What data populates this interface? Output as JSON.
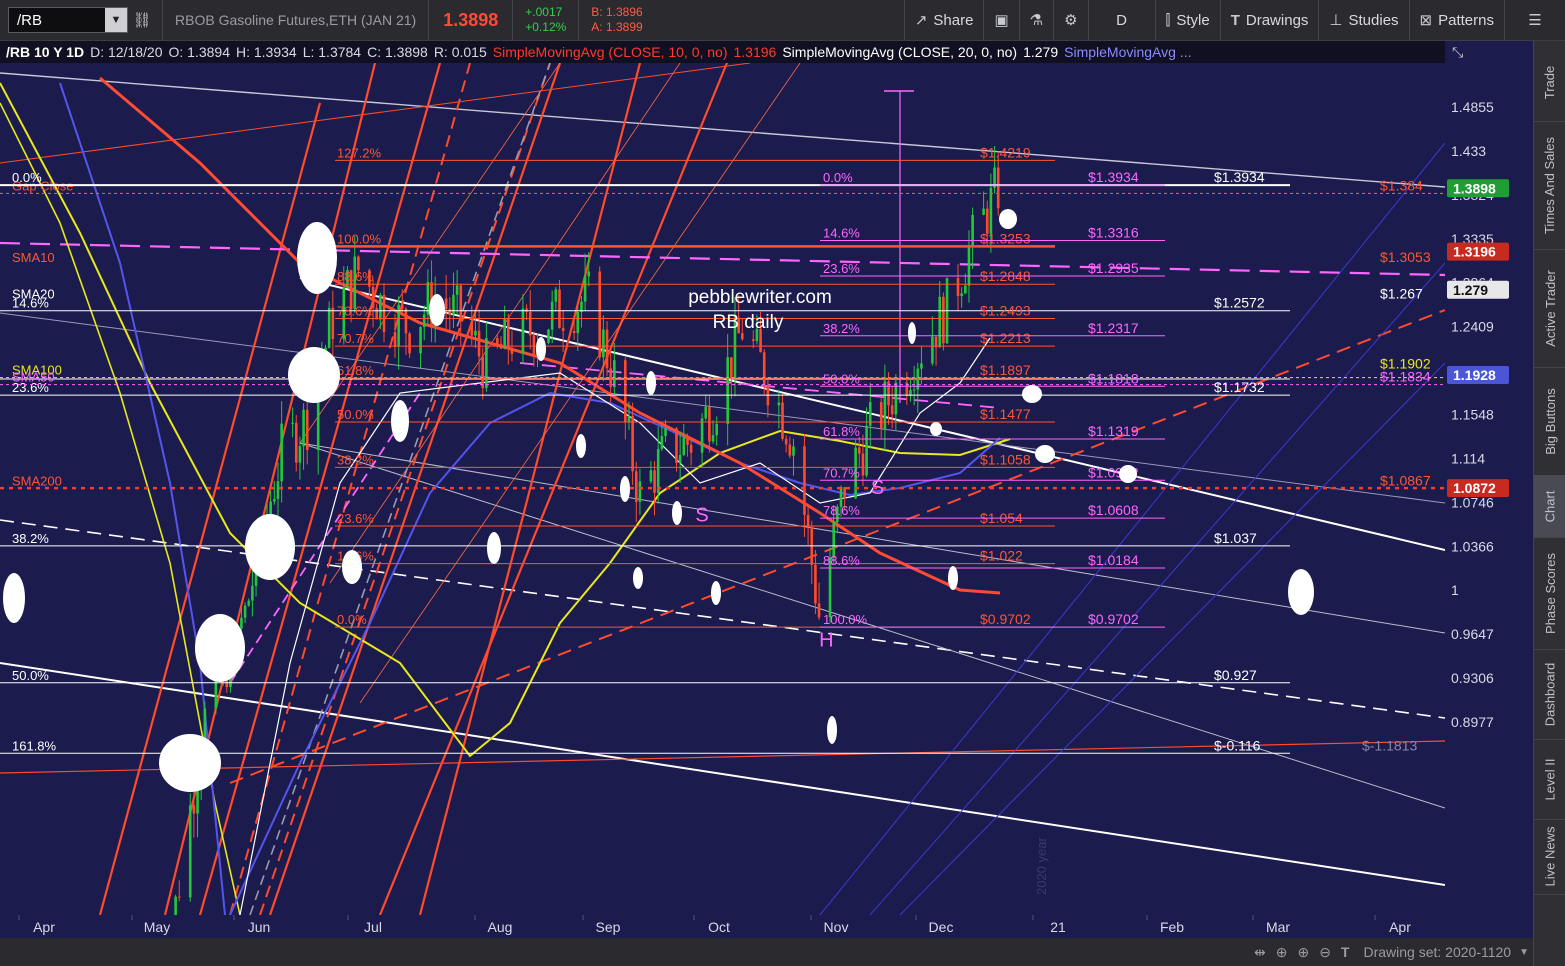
{
  "toolbar": {
    "symbol": "/RB",
    "description": "RBOB Gasoline Futures,ETH (JAN 21)",
    "last": "1.3898",
    "change": "+.0017",
    "change_pct": "+0.12%",
    "bid": "B: 1.3896",
    "ask": "A: 1.3899",
    "share": "Share",
    "aggregation": "D",
    "style": "Style",
    "drawings": "Drawings",
    "studies": "Studies",
    "patterns": "Patterns"
  },
  "studybar": {
    "symbol_period": "/RB 10 Y 1D",
    "date": "D: 12/18/20",
    "open": "O: 1.3894",
    "high": "H: 1.3934",
    "low": "L: 1.3784",
    "close": "C: 1.3898",
    "range": "R: 0.015",
    "sma10_label": "SimpleMovingAvg (CLOSE, 10, 0, no)",
    "sma10_value": "1.3196",
    "sma20_label": "SimpleMovingAvg (CLOSE, 20, 0, no)",
    "sma20_value": "1.279",
    "sma_more": "SimpleMovingAvg ..."
  },
  "watermark": {
    "site": "pebblewriter.com",
    "title": "RB daily",
    "year": "2020 year"
  },
  "sidebar": [
    "Trade",
    "Times And Sales",
    "Active Trader",
    "Big Buttons",
    "Chart",
    "Phase Scores",
    "Dashboard",
    "Level II",
    "Live News"
  ],
  "bottombar": {
    "drawing_set": "Drawing set: 2020-1120"
  },
  "colors": {
    "background": "#1b1b4d",
    "bull": "#22c83c",
    "bear": "#ff4b2b",
    "fib": "#ff5533",
    "pink": "#ff66ff",
    "sma_yellow": "#e8e81a",
    "sma_blue": "#5555ee"
  },
  "chart_data": {
    "type": "candlestick",
    "x_ticks": [
      "Apr",
      "May",
      "Jun",
      "Jul",
      "Aug",
      "Sep",
      "Oct",
      "Nov",
      "Dec",
      "21",
      "Feb",
      "Mar",
      "Apr"
    ],
    "y_ticks": [
      "1.4855",
      "1.433",
      "1.3824",
      "1.3335",
      "1.2864",
      "1.2409",
      "1.1548",
      "1.114",
      "1.0746",
      "1.0366",
      "1",
      "0.9647",
      "0.9306",
      "0.8977"
    ],
    "y_scale": "log",
    "ylim": [
      0.87,
      1.53
    ],
    "close_series": [
      [
        "2020-04-01",
        0.8
      ],
      [
        "2020-04-21",
        0.62
      ],
      [
        "2020-05-05",
        0.74
      ],
      [
        "2020-05-15",
        0.9
      ],
      [
        "2020-05-26",
        0.98
      ],
      [
        "2020-06-05",
        1.12
      ],
      [
        "2020-06-12",
        1.15
      ],
      [
        "2020-06-19",
        1.25
      ],
      [
        "2020-06-26",
        1.3
      ],
      [
        "2020-07-03",
        1.26
      ],
      [
        "2020-07-10",
        1.24
      ],
      [
        "2020-07-17",
        1.27
      ],
      [
        "2020-07-24",
        1.25
      ],
      [
        "2020-07-31",
        1.2
      ],
      [
        "2020-08-07",
        1.23
      ],
      [
        "2020-08-14",
        1.24
      ],
      [
        "2020-08-21",
        1.26
      ],
      [
        "2020-08-28",
        1.27
      ],
      [
        "2020-09-04",
        1.19
      ],
      [
        "2020-09-11",
        1.08
      ],
      [
        "2020-09-18",
        1.12
      ],
      [
        "2020-09-25",
        1.13
      ],
      [
        "2020-10-02",
        1.17
      ],
      [
        "2020-10-09",
        1.24
      ],
      [
        "2020-10-16",
        1.19
      ],
      [
        "2020-10-23",
        1.13
      ],
      [
        "2020-10-30",
        0.98
      ],
      [
        "2020-11-06",
        1.09
      ],
      [
        "2020-11-13",
        1.14
      ],
      [
        "2020-11-20",
        1.18
      ],
      [
        "2020-11-27",
        1.22
      ],
      [
        "2020-12-04",
        1.26
      ],
      [
        "2020-12-11",
        1.33
      ],
      [
        "2020-12-18",
        1.3898
      ]
    ],
    "sma_lines": [
      {
        "name": "SMA10",
        "value": 1.3196,
        "color": "#ff4a34"
      },
      {
        "name": "SMA20",
        "value": 1.279,
        "color": "#ffffff"
      },
      {
        "name": "SMA50",
        "value": 1.1928,
        "color": "#7070ff"
      },
      {
        "name": "SMA100",
        "value": 1.1902,
        "color": "#e8e81a"
      },
      {
        "name": "SMA200",
        "value": 1.0872,
        "color": "#ff4a34"
      }
    ],
    "price_badges": [
      {
        "value": "1.3898",
        "bg": "#1f9e34"
      },
      {
        "value": "1.3196",
        "bg": "#c82a20"
      },
      {
        "value": "1.279",
        "bg": "#e8e8e8",
        "fg": "#111"
      },
      {
        "value": "1.1928",
        "bg": "#4a56d6"
      },
      {
        "value": "1.0872",
        "bg": "#c82a20"
      }
    ],
    "fib_left": [
      {
        "label": "0.0%",
        "price": 1.3934,
        "color": "#ffffff"
      },
      {
        "label": "Gap Close",
        "price": 1.384,
        "color": "#ff5533"
      },
      {
        "label": "SMA10",
        "price": 1.3053,
        "color": "#ff5533"
      },
      {
        "label": "SMA20",
        "price": 1.267,
        "color": "#ffffff"
      },
      {
        "label": "14.6%",
        "price": 1.2572,
        "color": "#ffffff"
      },
      {
        "label": "SMA100",
        "price": 1.1902,
        "color": "#e8e81a"
      },
      {
        "label": "SMA50",
        "price": 1.1834,
        "color": "#ff66ff"
      },
      {
        "label": "23.6%",
        "price": 1.1732,
        "color": "#ffffff"
      },
      {
        "label": "SMA200",
        "price": 1.0867,
        "color": "#ff5533"
      },
      {
        "label": "38.2%",
        "price": 1.037,
        "color": "#ffffff"
      },
      {
        "label": "50.0%",
        "price": 0.927,
        "color": "#ffffff"
      },
      {
        "label": "161.8%",
        "price": 0.875,
        "color": "#ffffff"
      }
    ],
    "fib_orange": [
      {
        "label": "127.2%",
        "price": 1.4219,
        "val": "$1.4219"
      },
      {
        "label": "100.0%",
        "price": 1.3253,
        "val": "$1.3253"
      },
      {
        "label": "88.6%",
        "price": 1.2848,
        "val": "$1.2848"
      },
      {
        "label": "78.6%",
        "price": 1.2493,
        "val": "$1.2493"
      },
      {
        "label": "70.7%",
        "price": 1.2213,
        "val": "$1.2213"
      },
      {
        "label": "61.8%",
        "price": 1.1897,
        "val": "$1.1897"
      },
      {
        "label": "50.0%",
        "price": 1.1477,
        "val": "$1.1477"
      },
      {
        "label": "38.2%",
        "price": 1.1058,
        "val": "$1.1058"
      },
      {
        "label": "23.6%",
        "price": 1.054,
        "val": "$1.054"
      },
      {
        "label": "14.6%",
        "price": 1.022,
        "val": "$1.022"
      },
      {
        "label": "0.0%",
        "price": 0.9702,
        "val": "$0.9702"
      }
    ],
    "fib_pink": [
      {
        "label": "0.0%",
        "price": 1.3934,
        "val": "$1.3934"
      },
      {
        "label": "14.6%",
        "price": 1.3316,
        "val": "$1.3316"
      },
      {
        "label": "23.6%",
        "price": 1.2935,
        "val": "$1.2935"
      },
      {
        "label": "38.2%",
        "price": 1.2317,
        "val": "$1.2317"
      },
      {
        "label": "50.0%",
        "price": 1.1818,
        "val": "$1.1818"
      },
      {
        "label": "61.8%",
        "price": 1.1319,
        "val": "$1.1319"
      },
      {
        "label": "70.7%",
        "price": 1.0942,
        "val": "$1.0942"
      },
      {
        "label": "78.6%",
        "price": 1.0608,
        "val": "$1.0608"
      },
      {
        "label": "88.6%",
        "price": 1.0184,
        "val": "$1.0184"
      },
      {
        "label": "100.0%",
        "price": 0.9702,
        "val": "$0.9702"
      }
    ],
    "right_labels": [
      {
        "text": "$1.3934",
        "price": 1.3934,
        "color": "#ffffff"
      },
      {
        "text": "$1.384",
        "price": 1.384,
        "color": "#ff5533"
      },
      {
        "text": "$1.3053",
        "price": 1.3053,
        "color": "#ff5533"
      },
      {
        "text": "$1.267",
        "price": 1.267,
        "color": "#ffffff"
      },
      {
        "text": "$1.2572",
        "price": 1.2572,
        "color": "#ffffff"
      },
      {
        "text": "$1.1902",
        "price": 1.1962,
        "color": "#e8e81a"
      },
      {
        "text": "$1.1834",
        "price": 1.1834,
        "color": "#ff66ff"
      },
      {
        "text": "$1.1732",
        "price": 1.1732,
        "color": "#ffffff"
      },
      {
        "text": "$1.0867",
        "price": 1.0867,
        "color": "#ff5533"
      },
      {
        "text": "$1.037",
        "price": 1.037,
        "color": "#ffffff"
      },
      {
        "text": "$0.927",
        "price": 0.927,
        "color": "#ffffff"
      },
      {
        "text": "$-0.116",
        "price": 0.875,
        "color": "#ffffff"
      },
      {
        "text": "$-1.1813",
        "price": 0.875,
        "color": "#8888aa"
      }
    ],
    "pattern_labels": [
      {
        "text": "S",
        "date": "2020-09-28",
        "price": 1.058
      },
      {
        "text": "H",
        "date": "2020-11-01",
        "price": 0.955
      },
      {
        "text": "S",
        "date": "2020-11-15",
        "price": 1.082
      }
    ]
  }
}
